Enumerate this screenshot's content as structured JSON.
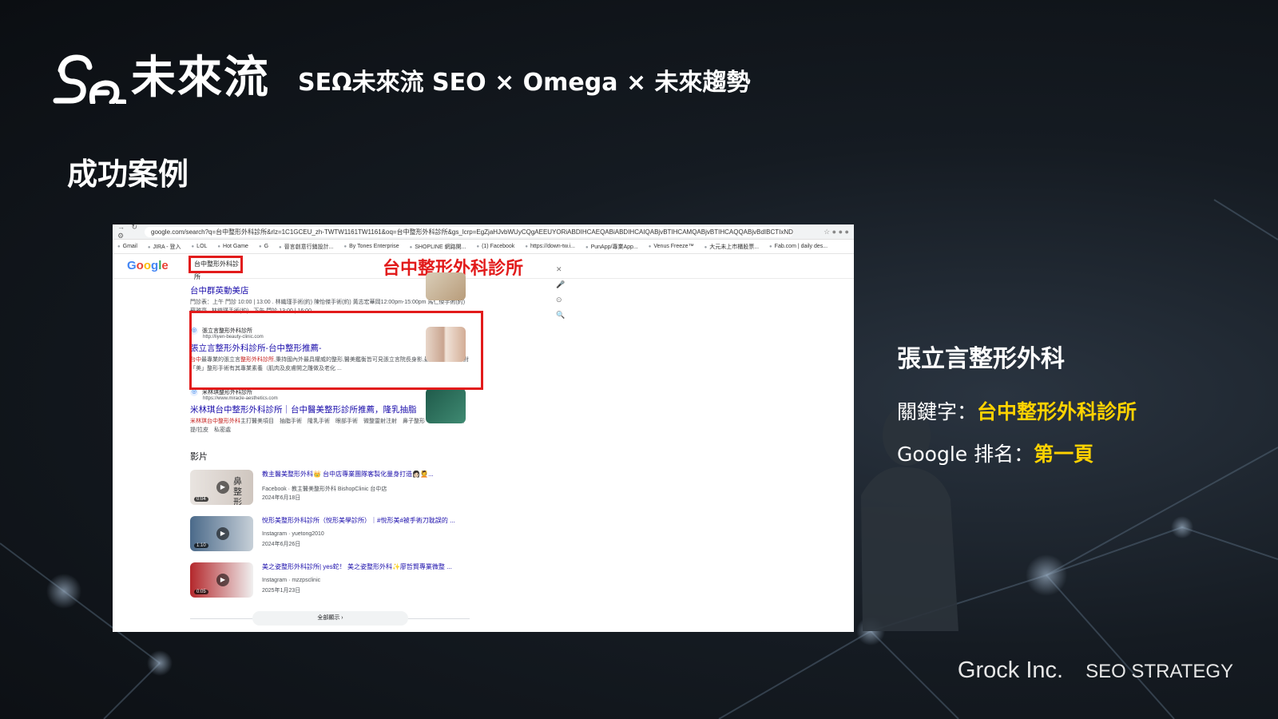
{
  "header": {
    "logo_text": "未來流",
    "title": "SEΩ未來流 SEO × Omega × 未來趨勢"
  },
  "section_title": "成功案例",
  "case": {
    "name": "張立言整形外科",
    "keyword_label": "關鍵字：",
    "keyword_value": "台中整形外科診所",
    "rank_label": "Google 排名：",
    "rank_value": "第一頁"
  },
  "footer": {
    "brand": "Grock Inc.",
    "tagline": "SEO STRATEGY"
  },
  "browser": {
    "url": "google.com/search?q=台中整形外科診所&rlz=1C1GCEU_zh-TWTW1161TW1161&oq=台中整形外科診所&gs_lcrp=EgZjaHJvbWUyCQgAEEUYORiABDIHCAEQABiABDIHCAIQABjvBTIHCAMQABjvBTIHCAQQABjvBdIBCTIxNDYxa...",
    "bookmarks": [
      "Gmail",
      "JIRA - 登入",
      "LOL",
      "Hot Game",
      "G",
      "晉言創意行銷設計...",
      "By Tones Enterprise",
      "SHOPLINE 網路開...",
      "(1) Facebook",
      "https://down-tw.i...",
      "PunApp/專業App...",
      "Venus Freeze™",
      "大元未上市櫃股票...",
      "Fab.com | daily des..."
    ],
    "google_logo": "Google",
    "search_query": "台中整形外科診所",
    "annotation": "台中整形外科診所",
    "results": [
      {
        "title": "台中群英動美店",
        "snippet": "門診表：上午 門診 10:00 | 13:00 . 林織瑾手術(約) 陳怡傑手術(約) 黃志宏華岡12:00pm-15:00pm 馬仁傑手術(約) 蘇雅齊 . 林織瑾手術(約) . 下午 門診 13:00 | 16:00 ..."
      },
      {
        "site": "張立言整形外科診所",
        "url": "http://liyen-beauty-clinic.com",
        "title": "張立言整形外科診所-台中整形推薦-",
        "snippet_red": "台中",
        "snippet_pre": "最專業的張立言",
        "snippet_red2": "整形外科診所",
        "snippet_post": ",秉持國內外最具權威的整形,醫美鑑衡皆可見張立言院長身影,最好的整形醫師對「美」整形手術有其專業素養（肌肉及皮膚開之雕做及老化 ..."
      },
      {
        "site": "米林琪整形外科診所",
        "url": "https://www.miracle-aesthetics.com",
        "title": "米林琪台中整形外科診所｜台中醫美整形診所推薦，隆乳抽脂",
        "snippet_red": "米林琪台中整形外科",
        "snippet_post": "主打醫美項目　抽脂手術　隆乳手術　眼部手術　微整靈射注射　鼻子整形　眼睛整形　拉提/拉皮　私密處"
      }
    ],
    "videos_heading": "影片",
    "videos": [
      {
        "title": "教主醫美整形外科👑 台中店專業團隊客製化量身打造👩🏻💆...",
        "source": "Facebook · 教主醫美整形外科 BishopClinic 台中店",
        "date": "2024年6月18日",
        "duration": "0:04",
        "thumb_text": "鼻整形"
      },
      {
        "title": "悅形美整形外科診所（悅形美學診所）｜#悅形美#被手術刀耽誤的 ...",
        "source": "Instagram · yuetong2010",
        "date": "2024年6月26日",
        "duration": "1:10"
      },
      {
        "title": "美之姿整形外科診所| yes蛇！ 美之姿整形外科✨廖哲賢專業微整 ...",
        "source": "Instagram · mzzpsclinic",
        "date": "2025年1月23日",
        "duration": "0:05"
      }
    ],
    "show_all": "全部顯示 ›"
  },
  "colors": {
    "accent_yellow": "#ffd200",
    "highlight_red": "#e21b1b",
    "link_blue": "#1a0dab"
  }
}
